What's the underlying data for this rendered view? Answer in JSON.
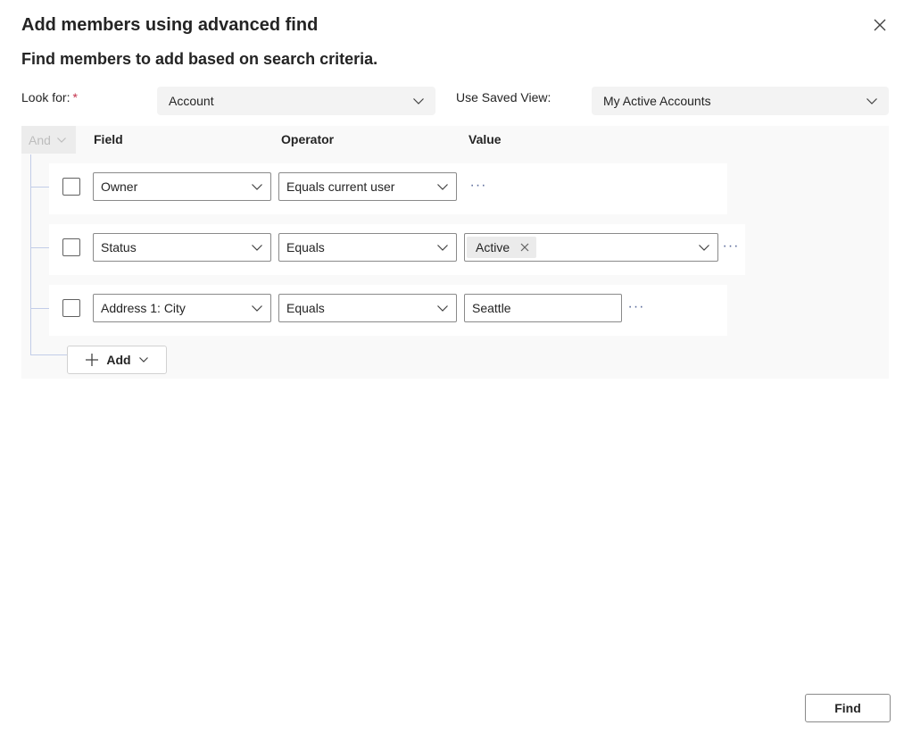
{
  "dialog": {
    "title": "Add members using advanced find",
    "subtitle": "Find members to add based on search criteria."
  },
  "look_for": {
    "label": "Look for:",
    "required_mark": "*",
    "value": "Account"
  },
  "saved_view": {
    "label": "Use Saved View:",
    "value": "My Active Accounts"
  },
  "filter": {
    "group_operator": "And",
    "headers": {
      "field": "Field",
      "operator": "Operator",
      "value": "Value"
    },
    "rows": [
      {
        "field": "Owner",
        "operator": "Equals current user",
        "value": ""
      },
      {
        "field": "Status",
        "operator": "Equals",
        "value_tag": "Active"
      },
      {
        "field": "Address 1: City",
        "operator": "Equals",
        "value": "Seattle"
      }
    ],
    "add_label": "Add",
    "more_glyph": "···"
  },
  "footer": {
    "find_label": "Find"
  },
  "colors": {
    "required": "#c4314b",
    "tree_line": "#c2cde8",
    "panel_bg": "#f9f9f9"
  }
}
